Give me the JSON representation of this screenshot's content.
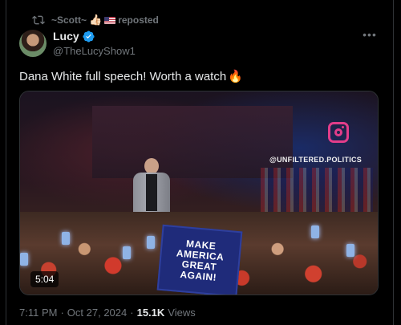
{
  "repost": {
    "user": "~Scott~",
    "emoji_thumb": "👍🏻",
    "flag_icon": "us-flag-icon",
    "label": "reposted"
  },
  "author": {
    "display_name": "Lucy",
    "handle": "@TheLucyShow1",
    "verified": true,
    "verified_color": "#1d9bf0"
  },
  "post": {
    "text": "Dana White full speech! Worth a watch",
    "emoji": "🔥"
  },
  "video": {
    "duration": "5:04",
    "watermark": "@UNFILTERED.POLITICS",
    "sign_lines": [
      "MAKE",
      "AMERICA",
      "GREAT",
      "AGAIN!"
    ]
  },
  "meta": {
    "time": "7:11 PM",
    "separator": "·",
    "date": "Oct 27, 2024",
    "views_count": "15.1K",
    "views_label": "Views"
  },
  "colors": {
    "background": "#000000",
    "text_primary": "#e7e9ea",
    "text_secondary": "#71767b",
    "border": "#2f3336"
  }
}
